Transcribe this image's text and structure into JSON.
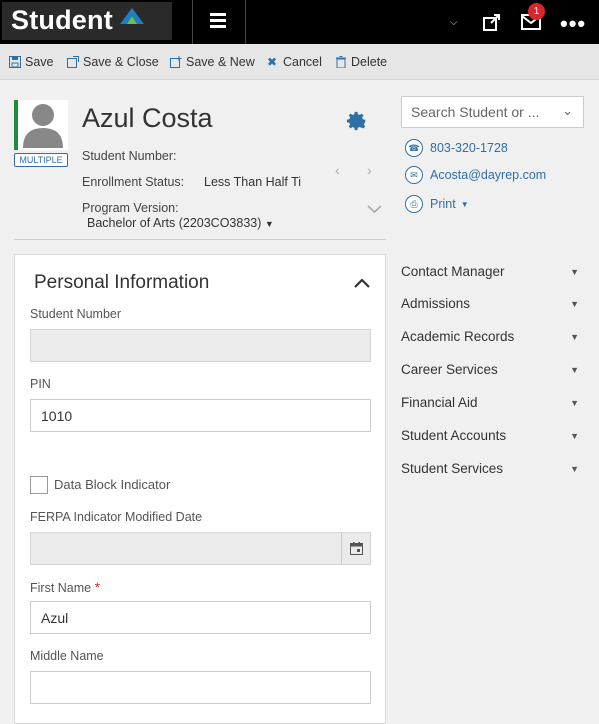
{
  "app": {
    "brand": "Student"
  },
  "topbar": {
    "mail_badge": "1"
  },
  "toolbar": {
    "save": "Save",
    "save_close": "Save & Close",
    "save_new": "Save & New",
    "cancel": "Cancel",
    "delete": "Delete"
  },
  "student": {
    "name": "Azul Costa",
    "badge": "MULTIPLE",
    "student_number_label": "Student Number:",
    "enrollment_status_label": "Enrollment Status:",
    "enrollment_status_value": "Less Than Half Ti",
    "program_version_label": "Program Version:",
    "program_version_value": "Bachelor of Arts (2203CO3833)"
  },
  "search": {
    "placeholder": "Search Student or ..."
  },
  "contact": {
    "phone": "803-320-1728",
    "email": "Acosta@dayrep.com",
    "print": "Print"
  },
  "right_menu": [
    "Contact Manager",
    "Admissions",
    "Academic Records",
    "Career Services",
    "Financial Aid",
    "Student Accounts",
    "Student Services"
  ],
  "form": {
    "title": "Personal Information",
    "student_number_label": "Student Number",
    "student_number_value": "",
    "pin_label": "PIN",
    "pin_value": "1010",
    "data_block_label": "Data Block Indicator",
    "ferpa_label": "FERPA Indicator Modified Date",
    "ferpa_value": "",
    "first_name_label": "First Name",
    "required_mark": "*",
    "first_name_value": "Azul",
    "middle_name_label": "Middle Name",
    "middle_name_value": ""
  },
  "colors": {
    "accent": "#2f6fa7",
    "brand_logo": "#1e7fc4",
    "required": "#d9262c",
    "status_bar": "#1f8b3a"
  }
}
